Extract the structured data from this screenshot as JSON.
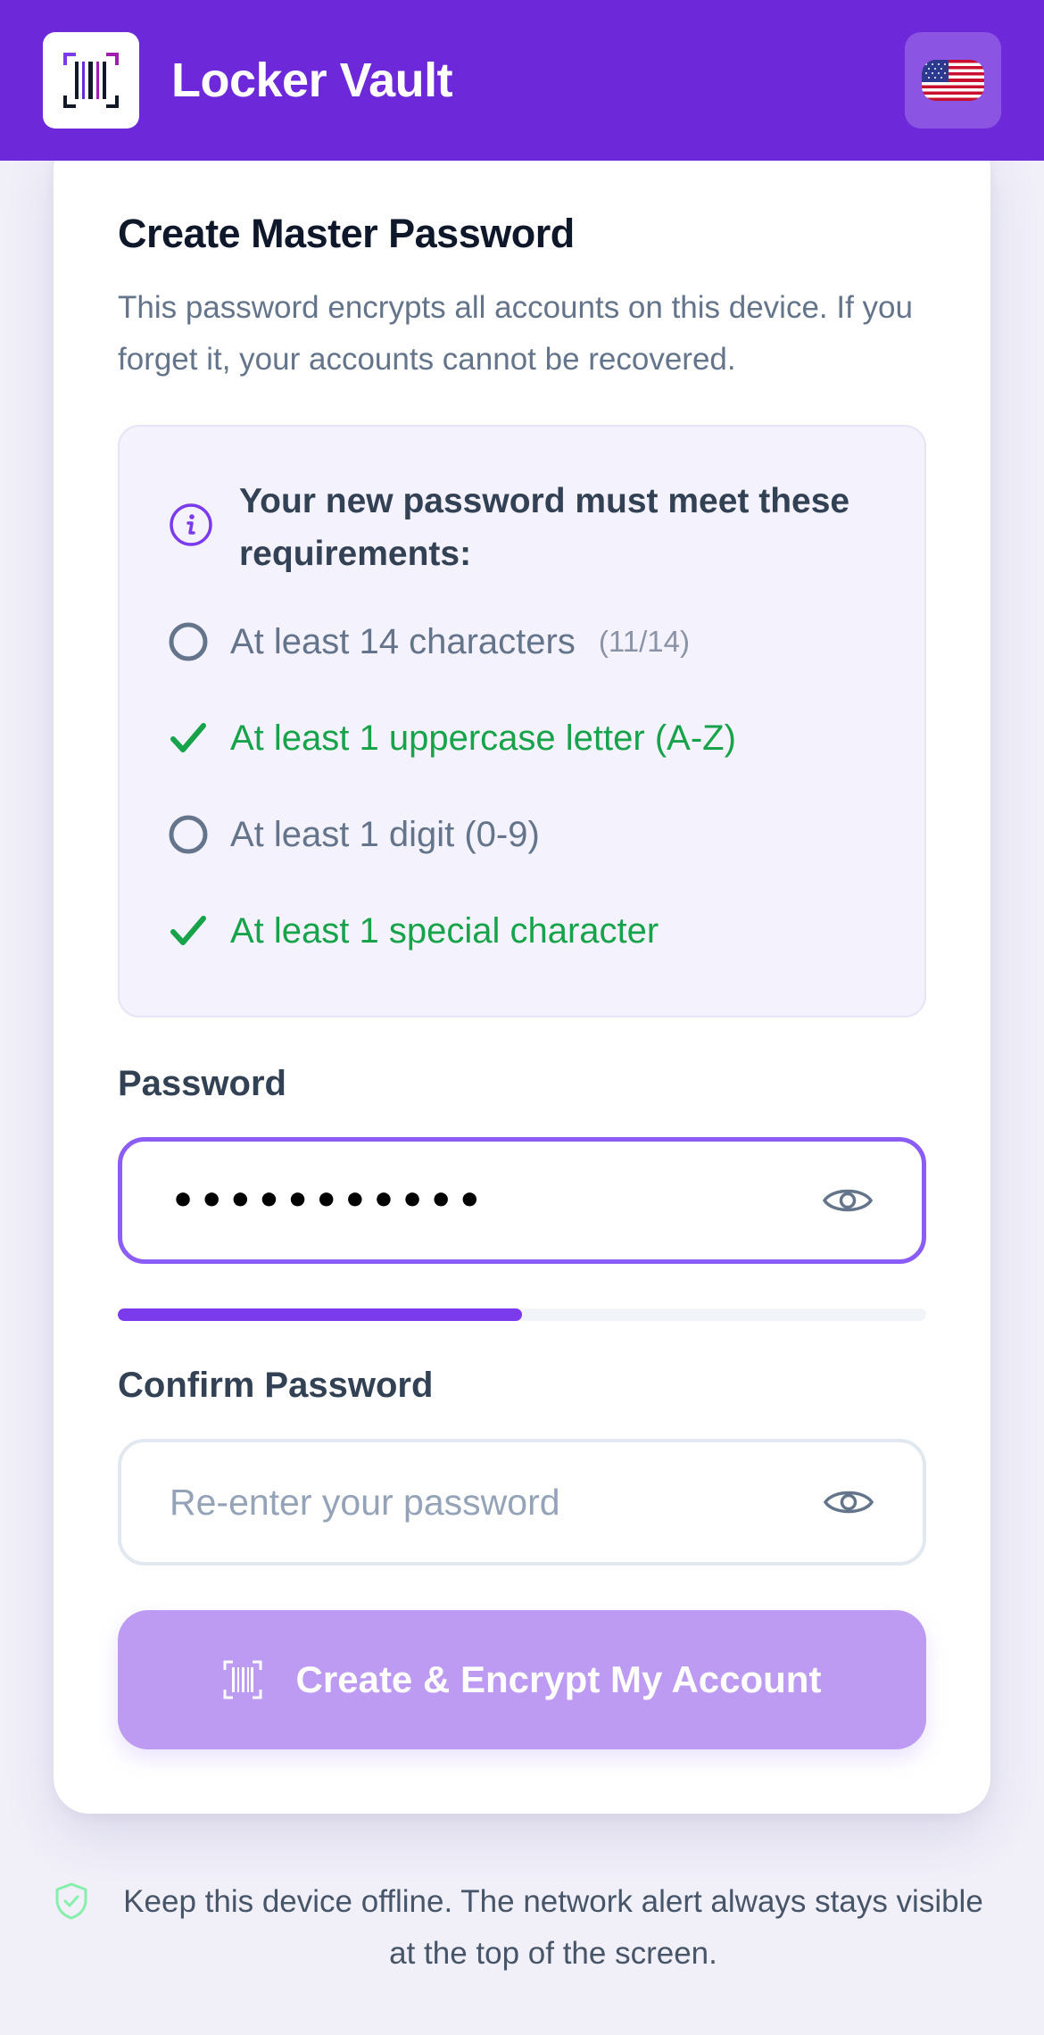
{
  "header": {
    "app_title": "Locker Vault",
    "logo_icon": "barcode-icon",
    "language_icon": "us-flag-icon",
    "background_color": "#6d28d9"
  },
  "card": {
    "title": "Create Master Password",
    "description": "This password encrypts all accounts on this device. If you forget it, your accounts cannot be recovered."
  },
  "requirements": {
    "title": "Your new password must meet these requirements:",
    "icon": "info-icon",
    "items": [
      {
        "label": "At least 14 characters",
        "met": false,
        "progress": "(11/14)"
      },
      {
        "label": "At least 1 uppercase letter (A-Z)",
        "met": true
      },
      {
        "label": "At least 1 digit (0-9)",
        "met": false
      },
      {
        "label": "At least 1 special character",
        "met": true
      }
    ],
    "met_color": "#16a34a",
    "unmet_color": "#64748b"
  },
  "password": {
    "label": "Password",
    "value": "•••••••••••",
    "strength_fraction": 0.5,
    "accent_color": "#7c3aed"
  },
  "confirm_password": {
    "label": "Confirm Password",
    "value": "",
    "placeholder": "Re-enter your password"
  },
  "submit": {
    "label": "Create & Encrypt My Account",
    "icon": "barcode-icon",
    "enabled": false
  },
  "footer": {
    "icon": "shield-check-icon",
    "text": "Keep this device offline. The network alert always stays visible at the top of the screen."
  }
}
